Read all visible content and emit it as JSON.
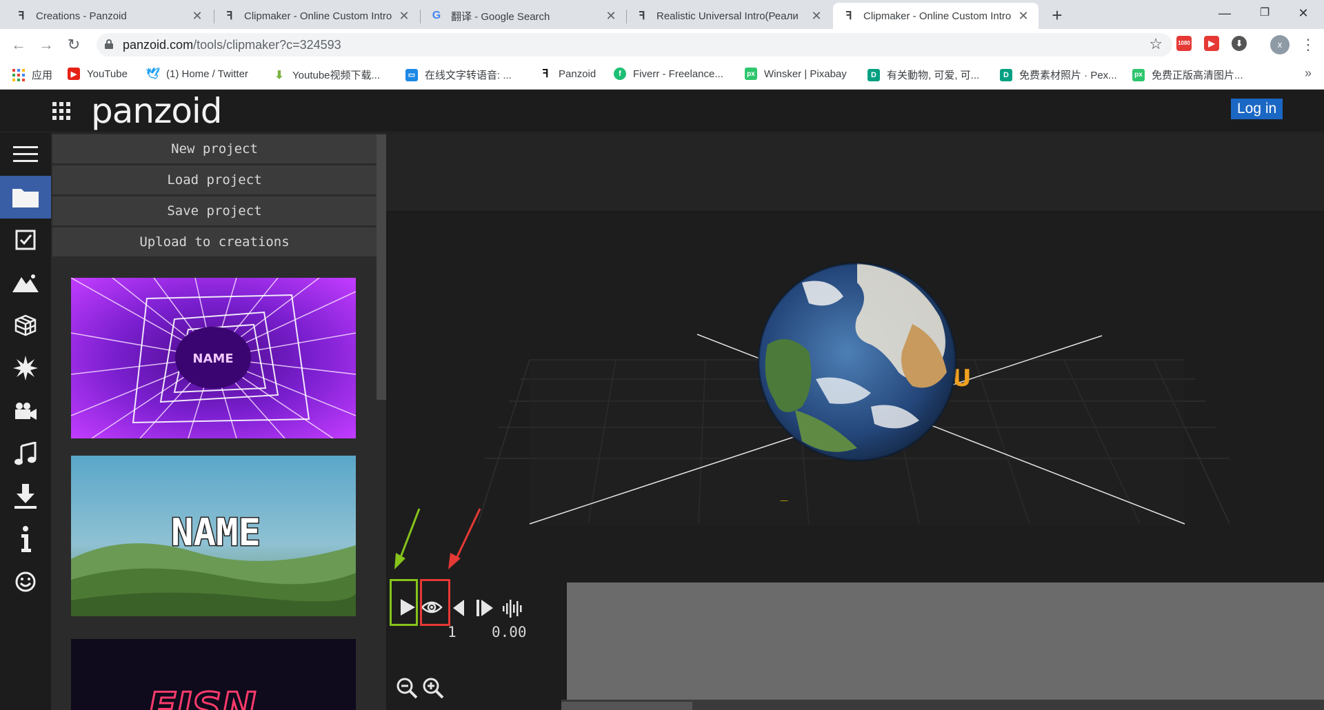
{
  "browser": {
    "tabs": [
      {
        "title": "Creations - Panzoid",
        "icon": "panzoid-favicon"
      },
      {
        "title": "Clipmaker - Online Custom Intro",
        "icon": "panzoid-favicon"
      },
      {
        "title": "翻译 - Google Search",
        "icon": "google-favicon"
      },
      {
        "title": "Realistic Universal Intro(Реали",
        "icon": "panzoid-favicon"
      },
      {
        "title": "Clipmaker - Online Custom Intro",
        "icon": "panzoid-favicon",
        "active": true
      }
    ],
    "url_host": "panzoid.com",
    "url_path": "/tools/clipmaker?c=324593",
    "ext_1080": "1080",
    "profile_initial": "x",
    "bookmarks": [
      {
        "label": "应用",
        "icon": "apps-grid-icon"
      },
      {
        "label": "YouTube",
        "icon": "youtube-icon"
      },
      {
        "label": "(1) Home / Twitter",
        "icon": "twitter-icon"
      },
      {
        "label": "Youtube视频下载...",
        "icon": "download-arrow-icon"
      },
      {
        "label": "在线文字转语音: ...",
        "icon": "chat-icon"
      },
      {
        "label": "Panzoid",
        "icon": "panzoid-favicon"
      },
      {
        "label": "Fiverr - Freelance...",
        "icon": "fiverr-icon"
      },
      {
        "label": "Winsker | Pixabay",
        "icon": "px-icon"
      },
      {
        "label": "有关動物, 可爱, 可...",
        "icon": "d-icon"
      },
      {
        "label": "免费素材照片 · Pex...",
        "icon": "d-icon"
      },
      {
        "label": "免费正版高清图片...",
        "icon": "px-icon"
      }
    ],
    "bookmarks_overflow": "»"
  },
  "app": {
    "logo": "panzoid",
    "login_label": "Log in",
    "rail": [
      "menu-icon",
      "folder-icon",
      "checkbox-icon",
      "image-icon",
      "cube-icon",
      "burst-icon",
      "camera-icon",
      "music-icon",
      "download-icon",
      "info-icon",
      "smiley-icon"
    ],
    "project_menu": {
      "new": "New project",
      "load": "Load project",
      "save": "Save project",
      "upload": "Upload to creations"
    },
    "thumbnails": [
      {
        "text": "NAME",
        "style": "purple-spiral"
      },
      {
        "text": "NAME",
        "style": "minecraft-landscape"
      },
      {
        "text": "FISN",
        "style": "neon-dark"
      }
    ],
    "timeline": {
      "frame": "1",
      "time": "0.00"
    },
    "colors": {
      "accent": "#3a5ea5",
      "login": "#1b67c4",
      "annotation_green": "#86c41b",
      "annotation_red": "#e53935"
    }
  }
}
